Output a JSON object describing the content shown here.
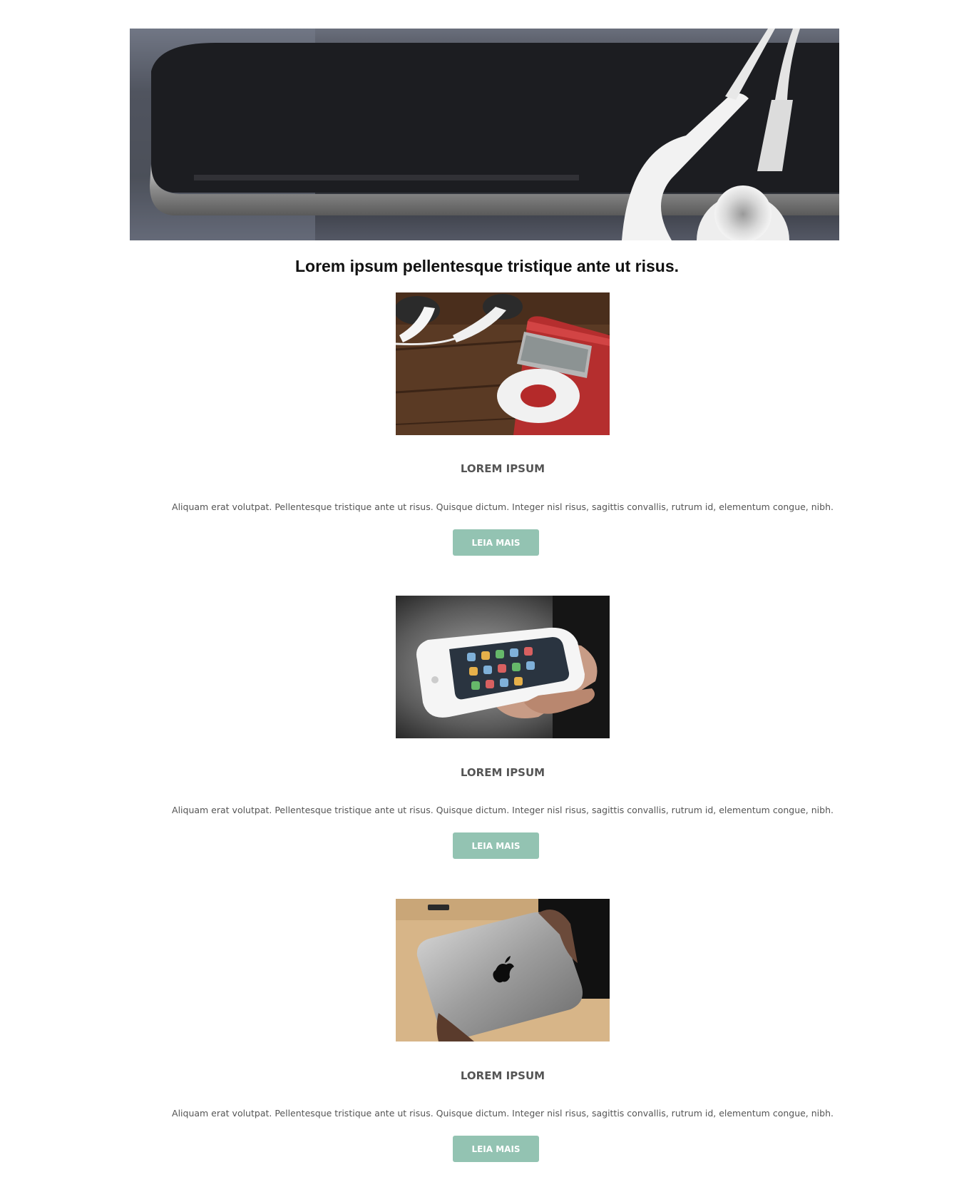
{
  "hero": {
    "image": "phone-and-earbuds-photo"
  },
  "headline": "Lorem ipsum pellentesque tristique ante ut risus.",
  "items": [
    {
      "image": "red-music-player-photo",
      "title": "LOREM IPSUM",
      "description": "Aliquam erat volutpat. Pellentesque tristique ante ut risus. Quisque dictum. Integer nisl risus, sagittis convallis, rutrum id, elementum congue, nibh.",
      "button_label": "LEIA MAIS"
    },
    {
      "image": "white-smartphone-in-hand-photo",
      "title": "LOREM IPSUM",
      "description": "Aliquam erat volutpat. Pellentesque tristique ante ut risus. Quisque dictum. Integer nisl risus, sagittis convallis, rutrum id, elementum congue, nibh.",
      "button_label": "LEIA MAIS"
    },
    {
      "image": "tablet-back-in-hands-photo",
      "title": "LOREM IPSUM",
      "description": "Aliquam erat volutpat. Pellentesque tristique ante ut risus. Quisque dictum. Integer nisl risus, sagittis convallis, rutrum id, elementum congue, nibh.",
      "button_label": "LEIA MAIS"
    }
  ],
  "colors": {
    "button_bg": "#93c3b2",
    "button_text": "#ffffff",
    "body_text": "#555555",
    "headline_text": "#111111"
  }
}
